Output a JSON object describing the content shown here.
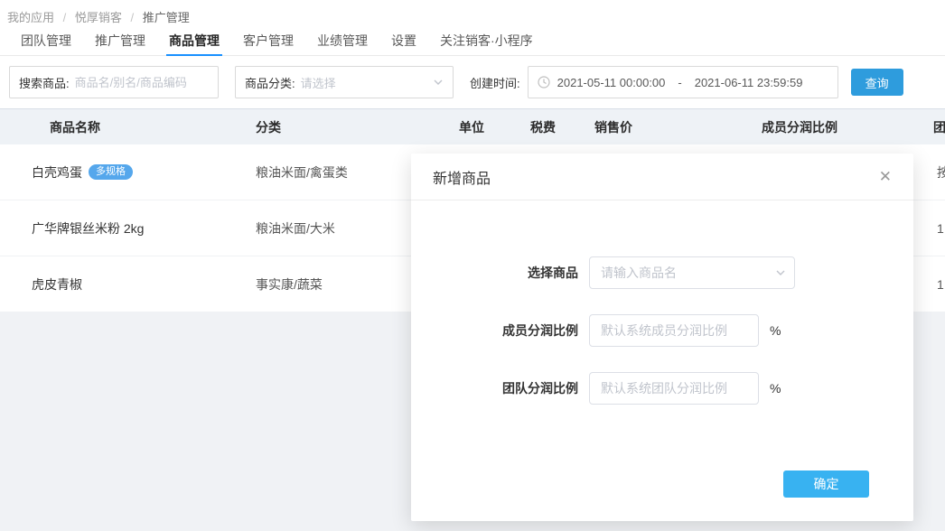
{
  "breadcrumb": {
    "separator": "/",
    "items": [
      "我的应用",
      "悦厚销客",
      "推广管理"
    ]
  },
  "nav": {
    "tabs": [
      {
        "label": "团队管理",
        "active": false
      },
      {
        "label": "推广管理",
        "active": false
      },
      {
        "label": "商品管理",
        "active": true
      },
      {
        "label": "客户管理",
        "active": false
      },
      {
        "label": "业绩管理",
        "active": false
      },
      {
        "label": "设置",
        "active": false
      },
      {
        "label": "关注销客·小程序",
        "active": false
      }
    ]
  },
  "filters": {
    "search_label": "搜索商品:",
    "search_placeholder": "商品名/别名/商品编码",
    "category_label": "商品分类:",
    "category_placeholder": "请选择",
    "date_label": "创建时间:",
    "date_start": "2021-05-11 00:00:00",
    "date_separator": "-",
    "date_end": "2021-06-11 23:59:59",
    "query_button": "查询"
  },
  "table": {
    "headers": [
      "商品名称",
      "分类",
      "单位",
      "税费",
      "销售价",
      "成员分润比例",
      "团队分润比例"
    ],
    "rows": [
      {
        "name": "白壳鸡蛋",
        "badge": "多规格",
        "category": "粮油米面/禽蛋类",
        "team_ratio": "按"
      },
      {
        "name": "广华牌银丝米粉 2kg",
        "category": "粮油米面/大米",
        "team_ratio": "1"
      },
      {
        "name": "虎皮青椒",
        "category": "事实康/蔬菜",
        "team_ratio": "1"
      }
    ]
  },
  "modal": {
    "title": "新增商品",
    "close_icon": "✕",
    "fields": [
      {
        "label": "选择商品",
        "placeholder": "请输入商品名"
      },
      {
        "label": "成员分润比例",
        "placeholder": "默认系统成员分润比例",
        "suffix": "%"
      },
      {
        "label": "团队分润比例",
        "placeholder": "默认系统团队分润比例",
        "suffix": "%"
      }
    ],
    "confirm_label": "确定"
  },
  "colors": {
    "accent": "#1890ff",
    "query_button": "#2e9cdd",
    "confirm_button": "#38b2f1",
    "badge": "#55a7ec",
    "table_header_bg": "#eef2f6",
    "page_bg": "#f0f2f5"
  }
}
